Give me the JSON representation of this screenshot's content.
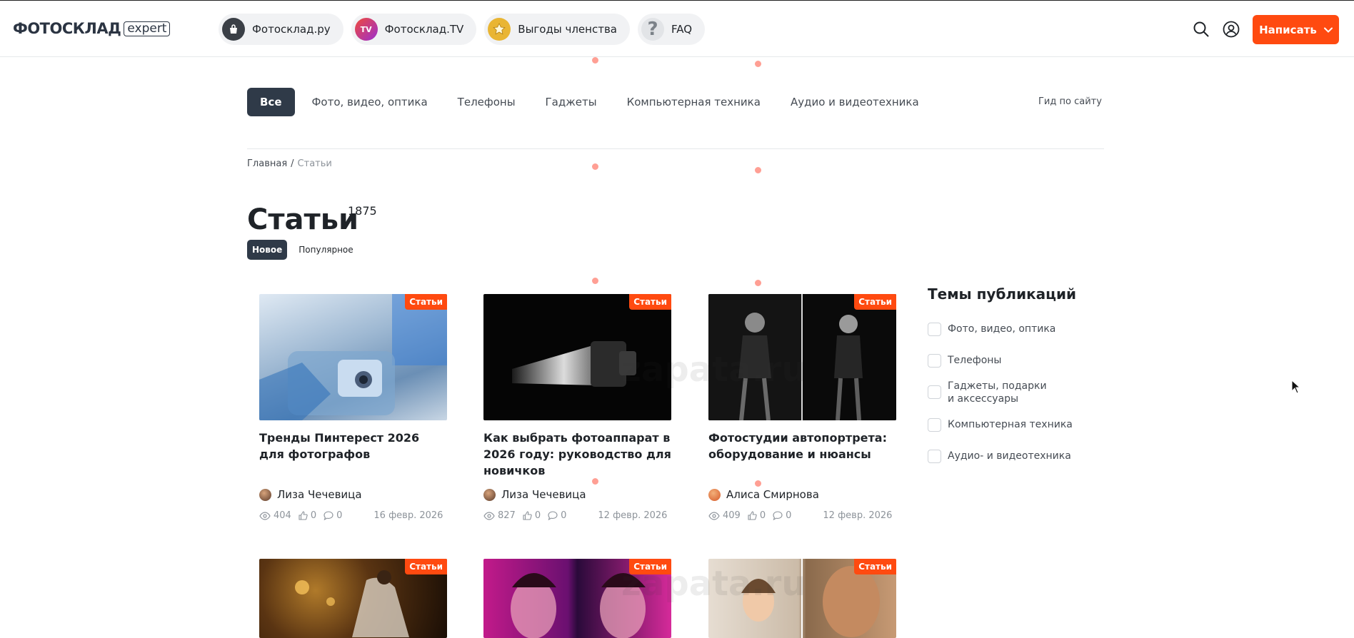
{
  "header": {
    "logo_main": "ФОТОСКЛАД",
    "logo_suffix": "expert",
    "pills": [
      {
        "label": "Фотосклад.ру",
        "icon": "shopping-bag-icon"
      },
      {
        "label": "Фотосклад.TV",
        "icon": "tv-icon",
        "icon_text": "TV"
      },
      {
        "label": "Выгоды членства",
        "icon": "star-badge-icon"
      },
      {
        "label": "FAQ",
        "icon": "question-icon",
        "icon_text": "?"
      }
    ],
    "write_label": "Написать",
    "accent": "#ff4a10"
  },
  "categories": {
    "items": [
      "Все",
      "Фото, видео, оптика",
      "Телефоны",
      "Гаджеты",
      "Компьютерная техника",
      "Аудио и видеотехника"
    ],
    "active": "Все",
    "guide": "Гид по сайту"
  },
  "breadcrumb": {
    "home": "Главная",
    "sep": "/",
    "current": "Статьи"
  },
  "page": {
    "title": "Статьи",
    "count": "1875"
  },
  "sort": {
    "new": "Новое",
    "popular": "Популярное"
  },
  "cards": [
    {
      "badge": "Статьи",
      "title": "Тренды Пинтерест 2026 для фотографов",
      "author": "Лиза Чечевица",
      "views": "404",
      "likes": "0",
      "comments": "0",
      "date": "16 февр. 2026"
    },
    {
      "badge": "Статьи",
      "title": "Как выбрать фотоаппарат в 2026 году: руководство для новичков",
      "author": "Лиза Чечевица",
      "views": "827",
      "likes": "0",
      "comments": "0",
      "date": "12 февр. 2026"
    },
    {
      "badge": "Статьи",
      "title": "Фотостудии автопортрета: оборудование и нюансы",
      "author": "Алиса Смирнова",
      "views": "409",
      "likes": "0",
      "comments": "0",
      "date": "12 февр. 2026"
    },
    {
      "badge": "Статьи"
    },
    {
      "badge": "Статьи"
    },
    {
      "badge": "Статьи"
    }
  ],
  "sidebar": {
    "title": "Темы публикаций",
    "topics": [
      "Фото, видео, оптика",
      "Телефоны",
      "Гаджеты, подарки и аксессуары",
      "Компьютерная техника",
      "Аудио- и видеотехника"
    ]
  },
  "watermark": "zapata.ru"
}
